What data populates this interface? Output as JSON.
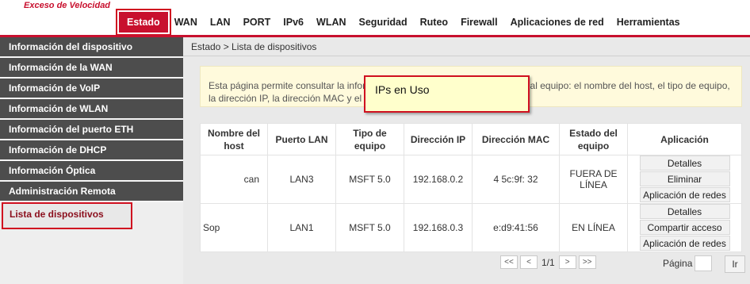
{
  "header": {
    "logo_text": "",
    "logo_sub": "Exceso de Velocidad",
    "model": "",
    "tabs": [
      {
        "label": "Estado",
        "active": true
      },
      {
        "label": "WAN"
      },
      {
        "label": "LAN"
      },
      {
        "label": "PORT"
      },
      {
        "label": "IPv6"
      },
      {
        "label": "WLAN"
      },
      {
        "label": "Seguridad"
      },
      {
        "label": "Ruteo"
      },
      {
        "label": "Firewall"
      },
      {
        "label": "Aplicaciones de red"
      },
      {
        "label": "Herramientas"
      }
    ],
    "accent_color": "#c8102e"
  },
  "sidebar": {
    "items": [
      {
        "label": "Información del dispositivo"
      },
      {
        "label": "Información de la WAN"
      },
      {
        "label": "Información de VoIP"
      },
      {
        "label": "Información de WLAN"
      },
      {
        "label": "Información del puerto ETH"
      },
      {
        "label": "Información de DHCP"
      },
      {
        "label": "Información Óptica"
      },
      {
        "label": "Administración Remota"
      },
      {
        "label": "Lista de dispositivos",
        "active": true
      }
    ]
  },
  "main": {
    "breadcrumb": "Estado > Lista de dispositivos",
    "info_text": "Esta página permite consultar la información de los dispositivos conectados al equipo: el nombre del host, el tipo de equipo, la dirección IP, la dirección MAC y el estado.",
    "tooltip": "IPs en Uso",
    "table": {
      "headers": [
        "Nombre del host",
        "Puerto LAN",
        "Tipo de equipo",
        "Dirección IP",
        "Dirección MAC",
        "Estado del equipo",
        "Aplicación"
      ],
      "rows": [
        {
          "host": "can",
          "port": "LAN3",
          "type": "MSFT 5.0",
          "ip": "192.168.0.2",
          "mac": "4  5c:9f:  32",
          "status": "FUERA DE LÍNEA",
          "actions": [
            "Detalles",
            "Eliminar",
            "Aplicación de redes"
          ]
        },
        {
          "host": "Sop",
          "port": "LAN1",
          "type": "MSFT 5.0",
          "ip": "192.168.0.3",
          "mac": "  e:d9:41:56",
          "status": "EN LÍNEA",
          "actions": [
            "Detalles",
            "Compartir acceso",
            "Aplicación de redes"
          ]
        }
      ]
    },
    "pager": {
      "first": "<<",
      "prev": "<",
      "current": "1/1",
      "next": ">",
      "last": ">>",
      "page_label": "Página",
      "page_value": "",
      "go_label": "Ir"
    }
  }
}
